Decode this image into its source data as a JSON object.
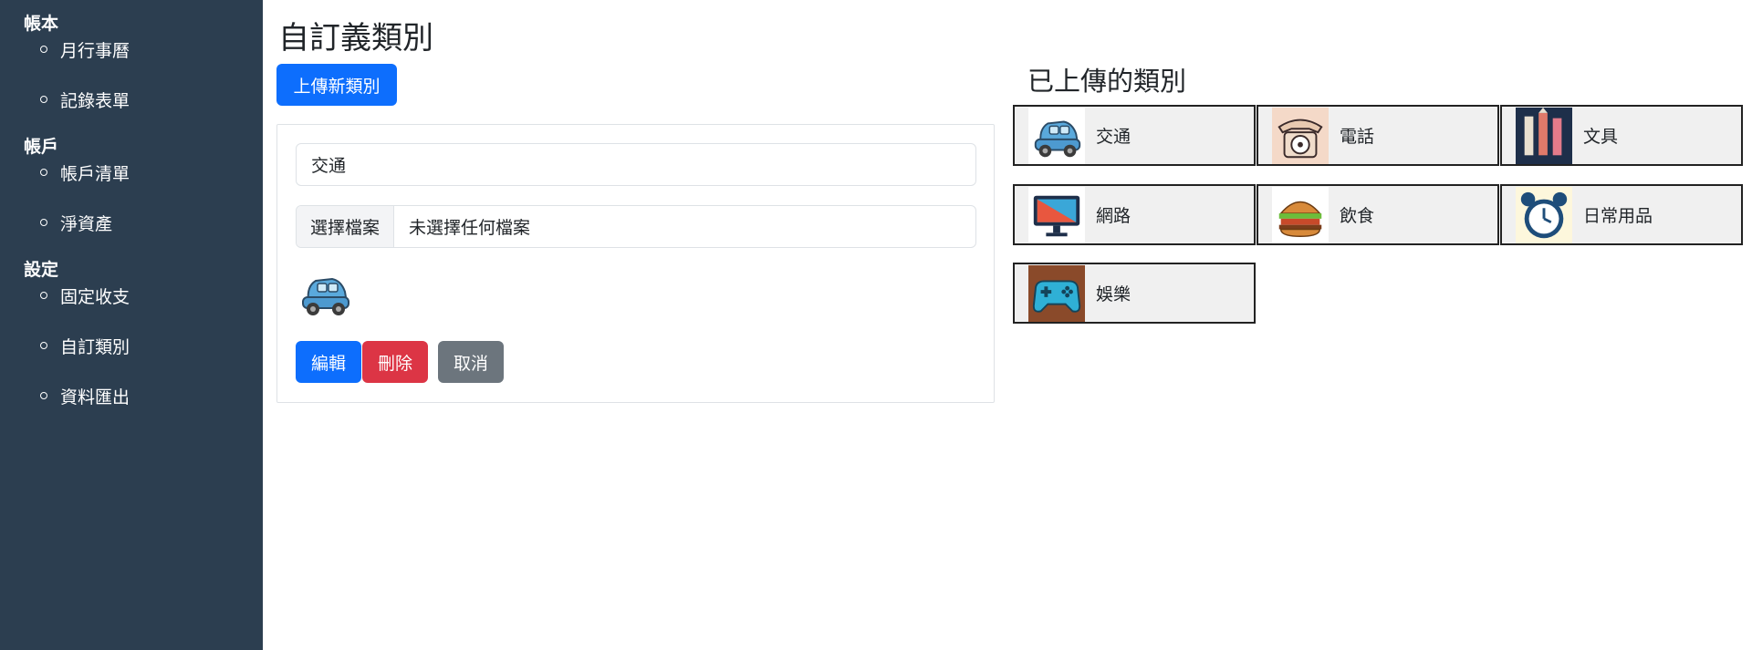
{
  "sidebar": {
    "groups": [
      {
        "title": "帳本",
        "items": [
          {
            "label": "月行事曆"
          },
          {
            "label": "記錄表單"
          }
        ]
      },
      {
        "title": "帳戶",
        "items": [
          {
            "label": "帳戶清單"
          },
          {
            "label": "淨資產"
          }
        ]
      },
      {
        "title": "設定",
        "items": [
          {
            "label": "固定收支"
          },
          {
            "label": "自訂類別"
          },
          {
            "label": "資料匯出"
          }
        ]
      }
    ]
  },
  "main": {
    "title": "自訂義類別",
    "upload_button": "上傳新類別",
    "form": {
      "name_value": "交通",
      "file_button": "選擇檔案",
      "file_status": "未選擇任何檔案",
      "preview_icon": "car-icon",
      "edit_button": "編輯",
      "delete_button": "刪除",
      "cancel_button": "取消"
    }
  },
  "uploaded": {
    "title": "已上傳的類別",
    "categories": [
      {
        "label": "交通",
        "icon": "car-icon"
      },
      {
        "label": "電話",
        "icon": "telephone-icon"
      },
      {
        "label": "文具",
        "icon": "stationery-icon"
      },
      {
        "label": "網路",
        "icon": "monitor-icon"
      },
      {
        "label": "飲食",
        "icon": "burger-icon"
      },
      {
        "label": "日常用品",
        "icon": "alarm-clock-icon"
      },
      {
        "label": "娛樂",
        "icon": "gamepad-icon"
      }
    ]
  },
  "colors": {
    "sidebar_bg": "#2c3e50",
    "primary": "#0d6efd",
    "danger": "#dc3545",
    "secondary": "#6c757d"
  }
}
